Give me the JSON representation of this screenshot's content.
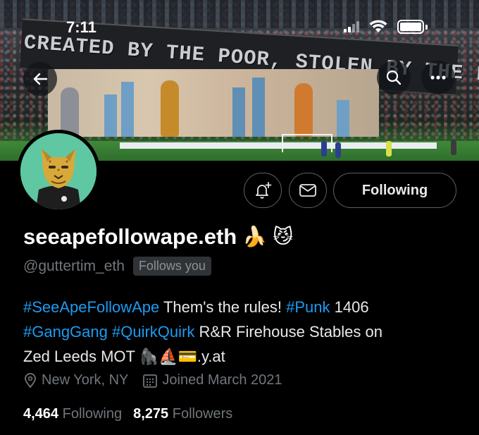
{
  "status_bar": {
    "time": "7:11"
  },
  "banner": {
    "sign_text": "CREATED BY THE POOR, STOLEN BY THE RICH"
  },
  "profile": {
    "display_name": "seeapefollowape.eth",
    "name_emojis": [
      "🍌",
      "😼"
    ],
    "handle": "@guttertim_eth",
    "follows_you_label": "Follows you",
    "bio": {
      "line1": [
        {
          "type": "tag",
          "text": "#SeeApeFollowApe"
        },
        {
          "type": "text",
          "text": " Them's the rules! "
        },
        {
          "type": "tag",
          "text": "#Punk"
        },
        {
          "type": "text",
          "text": " 1406"
        }
      ],
      "line2": [
        {
          "type": "tag",
          "text": "#GangGang"
        },
        {
          "type": "text",
          "text": " "
        },
        {
          "type": "tag",
          "text": "#QuirkQuirk"
        },
        {
          "type": "text",
          "text": " R&R Firehouse Stables on"
        }
      ],
      "line3": [
        {
          "type": "text",
          "text": "Zed Leeds MOT 🦍⛵💳.y.at"
        }
      ]
    },
    "location": "New York, NY",
    "joined": "Joined March 2021",
    "following_count": "4,464",
    "following_label": "Following",
    "followers_count": "8,275",
    "followers_label": "Followers"
  },
  "actions": {
    "following_button": "Following",
    "notify_icon": "bell-plus-icon",
    "message_icon": "envelope-icon"
  },
  "colors": {
    "background": "#000000",
    "link": "#1d9bf0",
    "muted": "#71767b",
    "avatar_bg": "#5fc7a2"
  }
}
